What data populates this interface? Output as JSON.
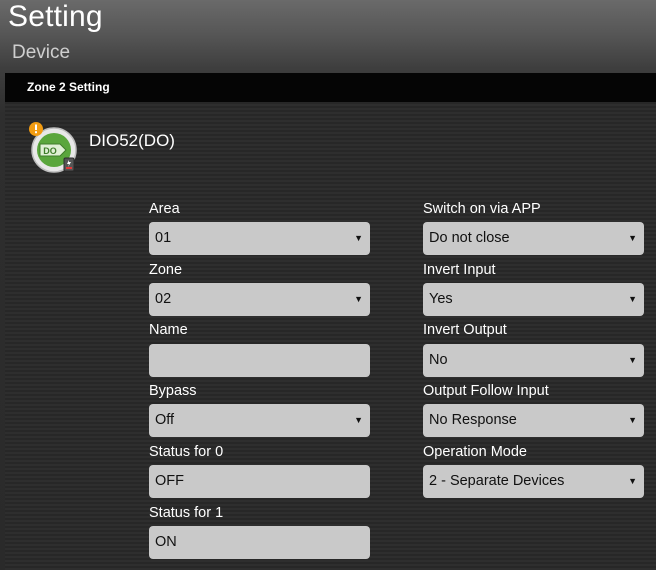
{
  "header": {
    "title": "Setting",
    "subtitle": "Device"
  },
  "panel": {
    "title": "Zone 2 Setting"
  },
  "device": {
    "name": "DIO52(DO)",
    "icon_text": "DO",
    "icon": "do-module-icon",
    "badge_icon": "warning-badge-icon",
    "accent_color": "#5aa63c",
    "badge_color": "#f39c12"
  },
  "form": {
    "left": [
      {
        "label": "Area",
        "type": "select",
        "value": "01"
      },
      {
        "label": "Zone",
        "type": "select",
        "value": "02"
      },
      {
        "label": "Name",
        "type": "text",
        "value": ""
      },
      {
        "label": "Bypass",
        "type": "select",
        "value": "Off"
      },
      {
        "label": "Status for 0",
        "type": "text",
        "value": "OFF"
      },
      {
        "label": "Status for 1",
        "type": "text",
        "value": "ON"
      }
    ],
    "right": [
      {
        "label": "Switch on via APP",
        "type": "select",
        "value": "Do not close"
      },
      {
        "label": "Invert Input",
        "type": "select",
        "value": "Yes"
      },
      {
        "label": "Invert Output",
        "type": "select",
        "value": "No"
      },
      {
        "label": "Output Follow Input",
        "type": "select",
        "value": "No Response"
      },
      {
        "label": "Operation Mode",
        "type": "select",
        "value": "2 - Separate Devices"
      }
    ],
    "caret_glyph": "▼"
  }
}
